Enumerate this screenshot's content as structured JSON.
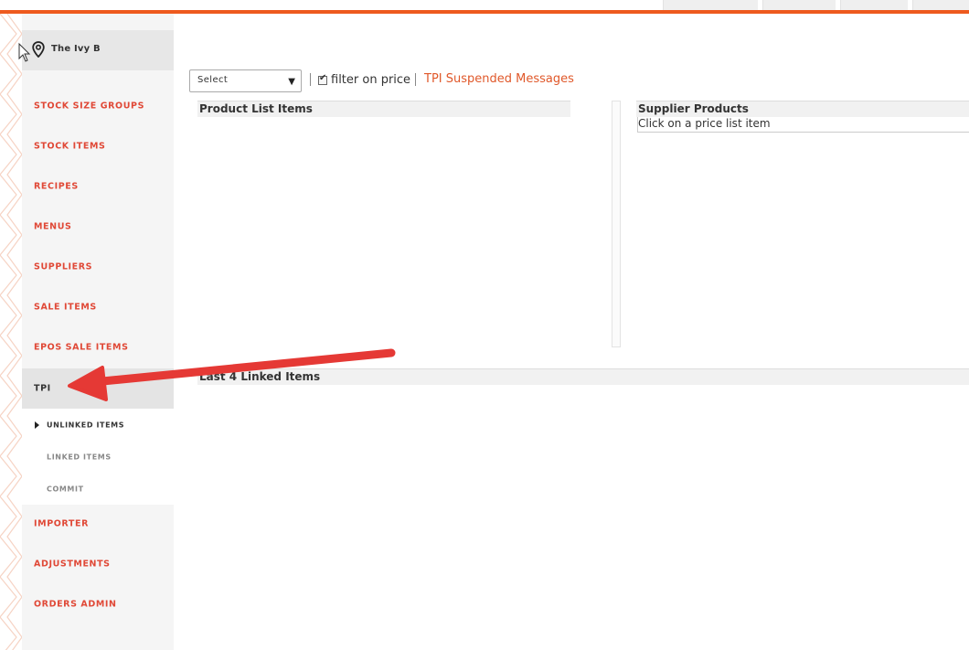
{
  "location": {
    "name": "The Ivy B"
  },
  "sidebar": {
    "items": [
      {
        "label": "STOCK SIZE GROUPS"
      },
      {
        "label": "STOCK ITEMS"
      },
      {
        "label": "RECIPES"
      },
      {
        "label": "MENUS"
      },
      {
        "label": "SUPPLIERS"
      },
      {
        "label": "SALE ITEMS"
      },
      {
        "label": "EPOS SALE ITEMS"
      },
      {
        "label": "TPI"
      },
      {
        "label": "IMPORTER"
      },
      {
        "label": "ADJUSTMENTS"
      },
      {
        "label": "ORDERS ADMIN"
      }
    ],
    "sub_items": [
      {
        "label": "UNLINKED ITEMS"
      },
      {
        "label": "LINKED ITEMS"
      },
      {
        "label": "COMMIT"
      }
    ]
  },
  "toolbar": {
    "select_value": "Select",
    "filter_label": "filter on price",
    "filter_checked": true,
    "tpi_link": "TPI Suspended Messages"
  },
  "panels": {
    "product_list_title": "Product List Items",
    "supplier_products_title": "Supplier Products",
    "supplier_hint": "Click on a price list item",
    "last_linked_title": "Last 4 Linked Items"
  },
  "colors": {
    "accent": "#ee5a1e",
    "nav_label": "#e04836",
    "annotation_arrow": "#e53935"
  }
}
